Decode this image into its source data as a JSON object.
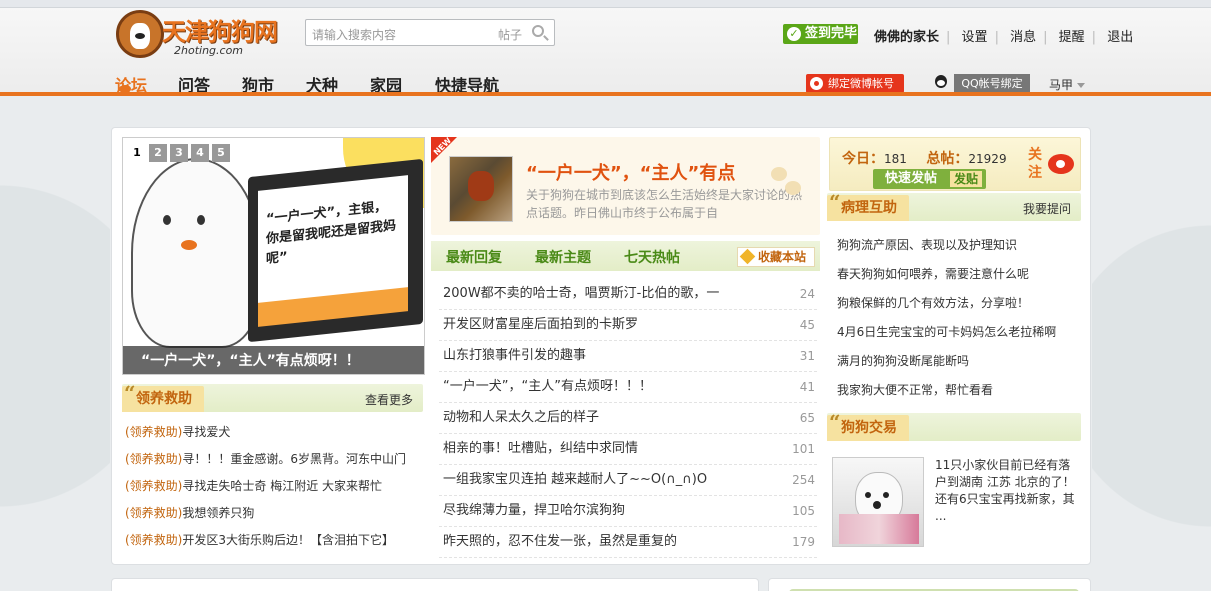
{
  "site": {
    "logo_text": "天津狗狗网",
    "logo_domain": "2hoting.com"
  },
  "search": {
    "placeholder": "请输入搜索内容",
    "type_label": "帖子"
  },
  "user": {
    "signin_label": "签到完毕",
    "username": "佛佛的家长",
    "links": [
      "设置",
      "消息",
      "提醒",
      "退出"
    ]
  },
  "nav": {
    "items": [
      "论坛",
      "问答",
      "狗市",
      "犬种",
      "家园",
      "快捷导航"
    ],
    "active": "论坛"
  },
  "bind": {
    "weibo": "绑定微博帐号",
    "qq": "QQ帐号绑定",
    "lang": "马甲"
  },
  "slideshow": {
    "pages": [
      "1",
      "2",
      "3",
      "4",
      "5"
    ],
    "current_page": "1",
    "screen_text": "“一户一犬”，主银，你是留我呢还是留我妈呢”",
    "caption": "“一户一犬”，“主人”有点烦呀！！"
  },
  "adoption": {
    "title": "领养救助",
    "more": "查看更多",
    "items": [
      {
        "tag": "(领养救助)",
        "text": "寻找爱犬"
      },
      {
        "tag": "(领养救助)",
        "text": "寻！！！重金感谢。6岁黑背。河东中山门"
      },
      {
        "tag": "(领养救助)",
        "text": "寻找走失哈士奇 梅江附近 大家来帮忙"
      },
      {
        "tag": "(领养救助)",
        "text": "我想领养只狗"
      },
      {
        "tag": "(领养救助)",
        "text": "开发区3大街乐购后边！【含泪拍下它】"
      }
    ]
  },
  "featured": {
    "new_label": "NEW",
    "title": "“一户一犬”，“主人”有点",
    "desc": "关于狗狗在城市到底该怎么生活始终是大家讨论的热点话题。昨日佛山市终于公布属于自"
  },
  "topic_tabs": {
    "tabs": [
      "最新回复",
      "最新主题",
      "七天热帖"
    ],
    "favorite": "收藏本站"
  },
  "topics": [
    {
      "title": "200W都不卖的哈士奇，唱贾斯汀-比伯的歌，一",
      "count": "24"
    },
    {
      "title": "开发区财富星座后面拍到的卡斯罗",
      "count": "45"
    },
    {
      "title": "山东打狼事件引发的趣事",
      "count": "31"
    },
    {
      "title": "“一户一犬”，“主人”有点烦呀！！！",
      "count": "41"
    },
    {
      "title": "动物和人呆太久之后的样子",
      "count": "65"
    },
    {
      "title": "相亲的事！吐槽贴，纠结中求同情",
      "count": "101"
    },
    {
      "title": "一组我家宝贝连拍 越来越耐人了~~O(∩_∩)O",
      "count": "254"
    },
    {
      "title": "尽我绵薄力量，捍卫哈尔滨狗狗",
      "count": "105"
    },
    {
      "title": "昨天照的，忍不住发一张，虽然是重复的",
      "count": "179"
    }
  ],
  "stats": {
    "today_label": "今日：",
    "today_value": "181",
    "total_label": "总帖：",
    "total_value": "21929",
    "post_button": "快速发帖",
    "post_button_tag": "发贴",
    "follow_label": "关注"
  },
  "sick": {
    "title": "病理互助",
    "more": "我要提问",
    "items": [
      "狗狗流产原因、表现以及护理知识",
      "春天狗狗如何喂养，需要注意什么呢",
      "狗粮保鲜的几个有效方法，分享啦！",
      "4月6日生完宝宝的可卡妈妈怎么老拉稀啊",
      "满月的狗狗没断尾能断吗",
      "我家狗大便不正常，帮忙看看"
    ]
  },
  "trade": {
    "title": "狗狗交易",
    "desc": "11只小家伙目前已经有落户到湖南 江苏 北京的了！ 还有6只宝宝再找新家，其 ..."
  },
  "colors": {
    "accent": "#e8731f",
    "green": "#4a8a17",
    "signin": "#5aa617",
    "weibo_red": "#e5351c"
  }
}
